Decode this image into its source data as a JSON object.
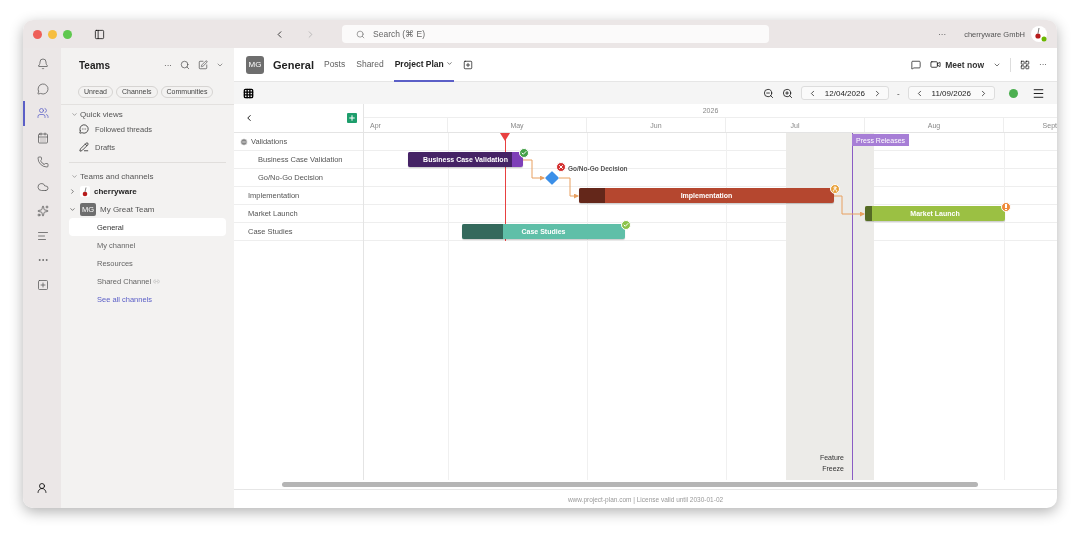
{
  "titlebar": {
    "search": {
      "placeholder": "Search (⌘ E)"
    },
    "more": "···",
    "org": "cherryware GmbH"
  },
  "rail": {
    "items": [
      {
        "selected": false
      },
      {
        "selected": false
      },
      {
        "selected": true
      },
      {
        "selected": false
      },
      {
        "selected": false
      },
      {
        "selected": false
      },
      {
        "selected": false
      },
      {
        "selected": false
      },
      {
        "selected": false
      },
      {
        "selected": false
      }
    ]
  },
  "sidebar": {
    "title": "Teams",
    "more": "···",
    "filters": [
      {
        "label": "Unread",
        "selected": false
      },
      {
        "label": "Channels",
        "selected": false
      },
      {
        "label": "Communities",
        "selected": false
      }
    ],
    "quick_views": {
      "title": "Quick views",
      "expanded": true,
      "items": [
        "Followed threads",
        "Drafts"
      ]
    },
    "teams_section": {
      "title": "Teams and channels",
      "expanded": true,
      "teams": [
        {
          "name": "cherryware",
          "expanded": false,
          "bold": true
        },
        {
          "name": "My Great Team",
          "avatar": "MG",
          "expanded": true,
          "bold": false,
          "channels": [
            {
              "label": "General",
              "selected": true,
              "shared": false
            },
            {
              "label": "My channel",
              "selected": false,
              "shared": false
            },
            {
              "label": "Resources",
              "selected": false,
              "shared": false
            },
            {
              "label": "Shared Channel",
              "selected": false,
              "shared": true
            }
          ],
          "link": "See all channels"
        }
      ]
    }
  },
  "header": {
    "avatar": "MG",
    "title": "General",
    "tabs": [
      {
        "label": "Posts",
        "selected": false
      },
      {
        "label": "Shared",
        "selected": false
      },
      {
        "label": "Project Plan",
        "selected": true
      }
    ],
    "meet": "Meet now",
    "more": "···"
  },
  "toolbar": {
    "start_date": "12/04/2026",
    "separator": "-",
    "end_date": "11/09/2026"
  },
  "gantt": {
    "year": "2026",
    "months": [
      "Apr",
      "May",
      "Jun",
      "Jul",
      "Aug",
      "Sept"
    ],
    "tasks": [
      {
        "label": "Validations",
        "expanded": true,
        "children": [
          {
            "label": "Business Case Validation"
          },
          {
            "label": "Go/No-Go Decision"
          }
        ]
      },
      {
        "label": "Implementation"
      },
      {
        "label": "Market Launch"
      },
      {
        "label": "Case Studies"
      }
    ],
    "bars": [
      {
        "label": "Business Case Validation",
        "kind": "bar",
        "color": "#7e3fb8",
        "level": 0.9
      },
      {
        "label": "Go/No-Go Decision",
        "kind": "milestone",
        "color": "#3b8fe8"
      },
      {
        "label": "Implementation",
        "kind": "bar",
        "color": "#b5472f",
        "level": 0.1
      },
      {
        "label": "Market Launch",
        "kind": "bar",
        "color": "#9bc043",
        "level": 0.05
      },
      {
        "label": "Case Studies",
        "kind": "bar",
        "color": "#5fbfa8",
        "level": 0.25
      }
    ],
    "marker": {
      "label": "Press Releases"
    },
    "freeze": {
      "label": "Feature Freeze"
    }
  },
  "footer": "www.project-plan.com | License valid until 2030-01-02"
}
